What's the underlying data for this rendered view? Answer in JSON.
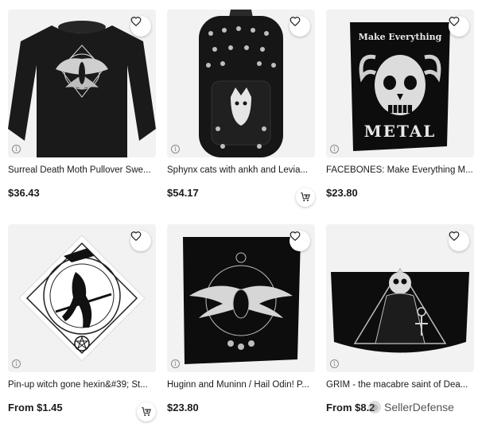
{
  "products": [
    {
      "title": "Surreal Death Moth Pullover Swe...",
      "price": "$36.43",
      "has_cart": false,
      "image": "black-sweatshirt-moth"
    },
    {
      "title": "Sphynx cats with ankh and Levia...",
      "price": "$54.17",
      "has_cart": true,
      "image": "black-backpack-sphynx"
    },
    {
      "title": "FACEBONES: Make Everything M...",
      "price": "$23.80",
      "has_cart": false,
      "image": "poster-skull-metal",
      "image_text_top": "Make Everything",
      "image_text_bottom": "METAL"
    },
    {
      "title": "Pin-up witch gone hexin&#39; St...",
      "price": "From $1.45",
      "has_cart": true,
      "image": "sticker-witch"
    },
    {
      "title": "Huginn and Muninn / Hail Odin! P...",
      "price": "$23.80",
      "has_cart": false,
      "image": "poster-raven"
    },
    {
      "title": "GRIM - the macabre saint of Dea...",
      "price": "From $8.2",
      "has_cart": false,
      "image": "mask-grim"
    }
  ],
  "watermark": {
    "text": "SellerDefense"
  },
  "colors": {
    "text": "#1b1b1f",
    "image_bg": "#f2f2f2",
    "dark_product": "#111111"
  },
  "icons": {
    "favorite": "heart-outline-icon",
    "cart": "add-to-cart-icon",
    "info": "info-icon"
  }
}
